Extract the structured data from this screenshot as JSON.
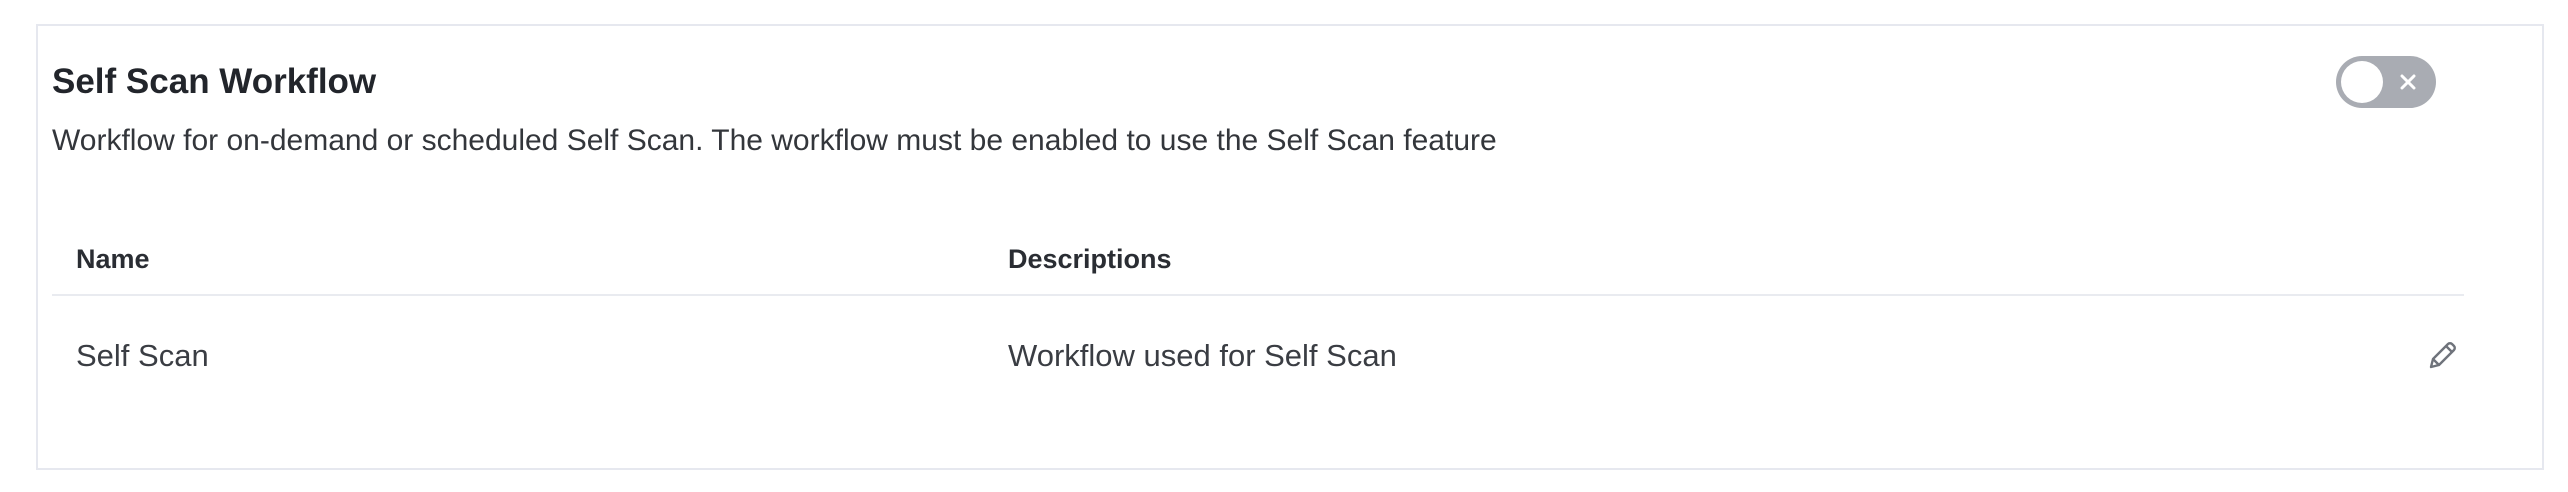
{
  "workflow_card": {
    "title": "Self Scan Workflow",
    "description": "Workflow for on-demand or scheduled Self Scan. The workflow must be enabled to use the Self Scan feature",
    "toggle": {
      "enabled": false,
      "off_icon": "close-icon"
    }
  },
  "table": {
    "columns": [
      "Name",
      "Descriptions"
    ],
    "rows": [
      {
        "name": "Self Scan",
        "description": "Workflow used for Self Scan",
        "action_icon": "pencil-icon"
      }
    ]
  },
  "colors": {
    "card_border": "#e6e8ef",
    "toggle_off": "#a9acb3",
    "divider": "#e9ebf0"
  }
}
